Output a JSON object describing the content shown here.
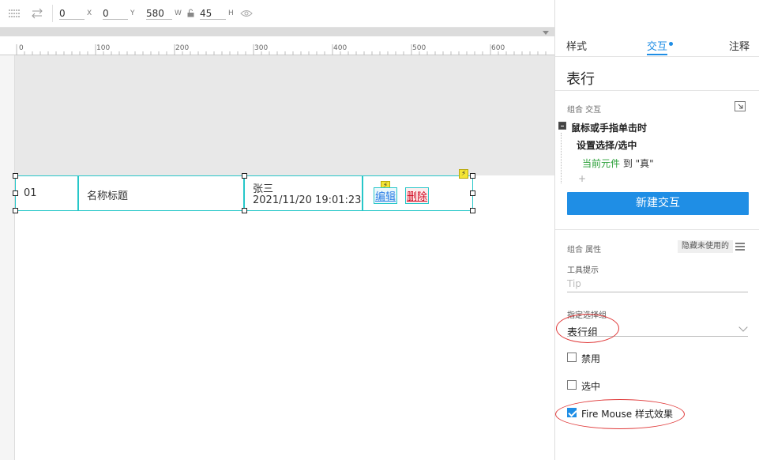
{
  "toolbar": {
    "x_value": "0",
    "x_unit": "X",
    "y_value": "0",
    "y_unit": "Y",
    "w_value": "580",
    "w_unit": "W",
    "h_value": "45",
    "h_unit": "H"
  },
  "ruler": {
    "labels": [
      "0",
      "100",
      "200",
      "300",
      "400",
      "500",
      "600"
    ]
  },
  "table_row": {
    "id": "01",
    "name": "名称标题",
    "person": "张三",
    "datetime": "2021/11/20 19:01:23",
    "edit_label": "编辑",
    "delete_label": "删除",
    "bolt_glyph": "⚡"
  },
  "panel": {
    "tabs": [
      "样式",
      "交互",
      "注释"
    ],
    "active_tab": "交互",
    "title": "表行",
    "interaction_section_label": "组合 交互",
    "event_label": "鼠标或手指单击时",
    "action_label": "设置选择/选中",
    "target_green": "当前元件",
    "target_rest": " 到 \"真\"",
    "add_glyph": "+",
    "new_interaction_button": "新建交互",
    "properties_section_label": "组合 属性",
    "hide_unused_label": "隐藏未使用的",
    "tooltip_label": "工具提示",
    "tooltip_placeholder": "Tip",
    "selection_group_label": "指定选择组",
    "selection_group_value": "表行组",
    "checkboxes": [
      {
        "label": "禁用",
        "checked": false
      },
      {
        "label": "选中",
        "checked": false
      },
      {
        "label": "Fire Mouse 样式效果",
        "checked": true
      }
    ]
  },
  "colors": {
    "accent": "#1f8ee5",
    "selection_border": "#27c7c9",
    "annotation_red": "#e03a3a",
    "delete_red": "#d0021b",
    "action_green": "#2aa038"
  }
}
